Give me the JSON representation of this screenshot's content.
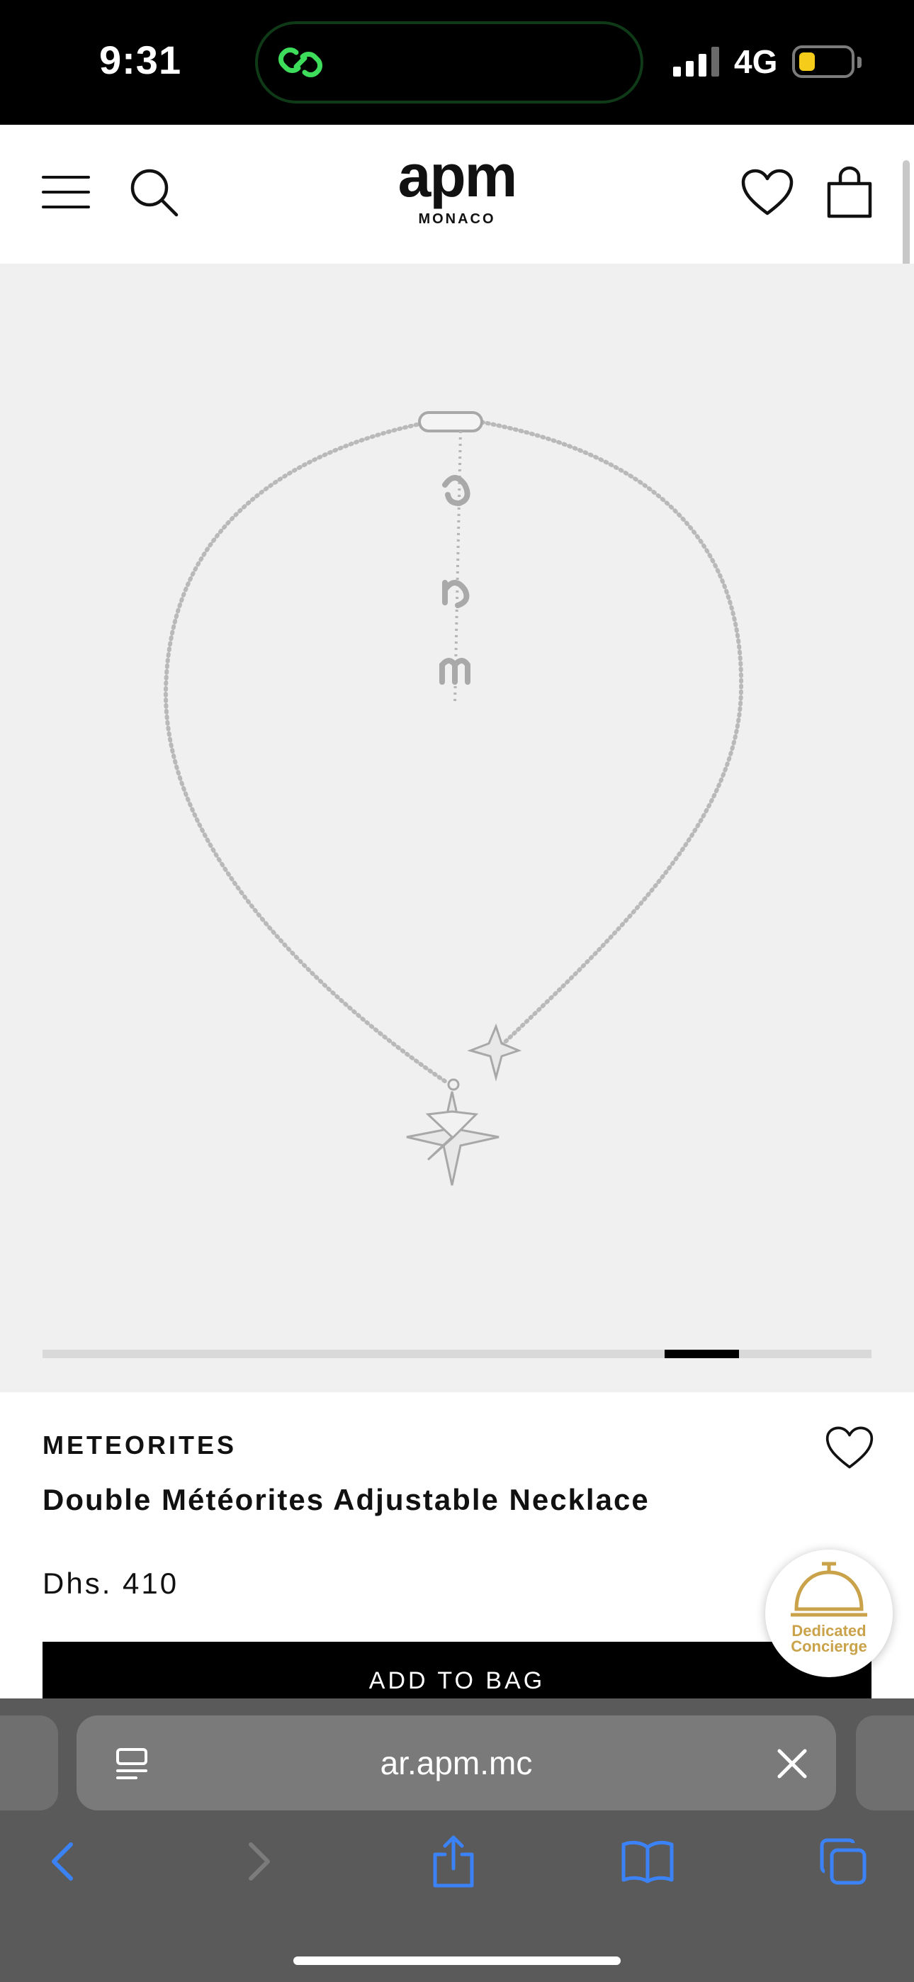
{
  "status_bar": {
    "time": "9:31",
    "network": "4G",
    "battery_color": "#f5cc1a"
  },
  "header": {
    "brand": {
      "name": "apm",
      "subtitle": "MONACO"
    },
    "icons": [
      "menu-icon",
      "search-icon",
      "heart-icon",
      "bag-icon"
    ]
  },
  "product_image": {
    "carousel_progress": {
      "start": 0.75,
      "end": 0.84
    }
  },
  "product": {
    "collection": "METEORITES",
    "name": "Double Météorites Adjustable Necklace",
    "price": "Dhs. 410",
    "add_to_bag_label": "ADD TO BAG"
  },
  "concierge": {
    "label_line1": "Dedicated",
    "label_line2": "Concierge"
  },
  "browser": {
    "url": "ar.apm.mc",
    "accent_color": "#3b82f6",
    "toolbar_icons": [
      "back-icon",
      "forward-icon",
      "share-icon",
      "bookmarks-icon",
      "tabs-icon"
    ]
  }
}
